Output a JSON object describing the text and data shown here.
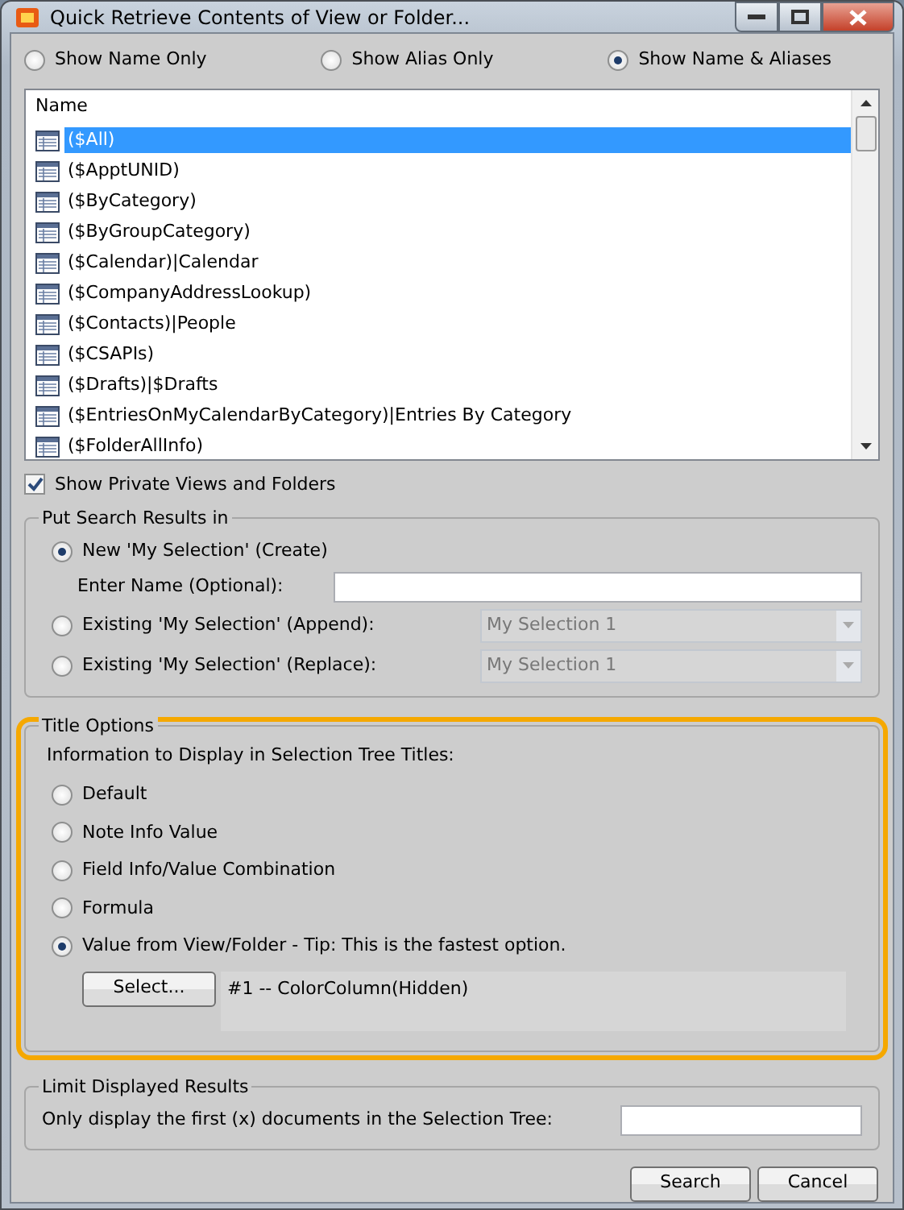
{
  "window": {
    "title": "Quick Retrieve Contents of View or Folder..."
  },
  "display_mode": [
    {
      "label": "Show Name Only",
      "selected": false
    },
    {
      "label": "Show Alias Only",
      "selected": false
    },
    {
      "label": "Show Name & Aliases",
      "selected": true
    }
  ],
  "list": {
    "column": "Name",
    "rows": [
      {
        "label": "($All)",
        "selected": true
      },
      {
        "label": "($ApptUNID)",
        "selected": false
      },
      {
        "label": "($ByCategory)",
        "selected": false
      },
      {
        "label": "($ByGroupCategory)",
        "selected": false
      },
      {
        "label": "($Calendar)|Calendar",
        "selected": false
      },
      {
        "label": "($CompanyAddressLookup)",
        "selected": false
      },
      {
        "label": "($Contacts)|People",
        "selected": false
      },
      {
        "label": "($CSAPIs)",
        "selected": false
      },
      {
        "label": "($Drafts)|$Drafts",
        "selected": false
      },
      {
        "label": "($EntriesOnMyCalendarByCategory)|Entries By Category",
        "selected": false
      },
      {
        "label": "($FolderAllInfo)",
        "selected": false
      }
    ]
  },
  "show_private": {
    "label": "Show Private Views and Folders",
    "checked": true
  },
  "results_group": {
    "title": "Put Search Results in",
    "options": [
      {
        "kind": "new",
        "label": "New 'My Selection' (Create)",
        "selected": true,
        "field_label": "Enter Name (Optional):"
      },
      {
        "kind": "combo",
        "label": "Existing 'My Selection' (Append):",
        "selected": false,
        "value": "My Selection 1",
        "disabled": true
      },
      {
        "kind": "combo",
        "label": "Existing 'My Selection' (Replace):",
        "selected": false,
        "value": "My Selection 1",
        "disabled": true
      }
    ]
  },
  "title_group": {
    "title": "Title Options",
    "highlighted": true,
    "intro": "Information to Display in Selection Tree Titles:",
    "options": [
      {
        "label": "Default",
        "selected": false
      },
      {
        "label": "Note Info Value",
        "selected": false
      },
      {
        "label": "Field Info/Value Combination",
        "selected": false
      },
      {
        "label": "Formula",
        "selected": false
      },
      {
        "label": "Value from View/Folder - Tip: This is the fastest option.",
        "selected": true
      }
    ],
    "select_button": "Select...",
    "column_value": "#1 -- ColorColumn(Hidden)"
  },
  "limit_group": {
    "title": "Limit Displayed Results",
    "label": "Only display the first (x) documents in the Selection Tree:"
  },
  "buttons": [
    "Search",
    "Cancel"
  ]
}
